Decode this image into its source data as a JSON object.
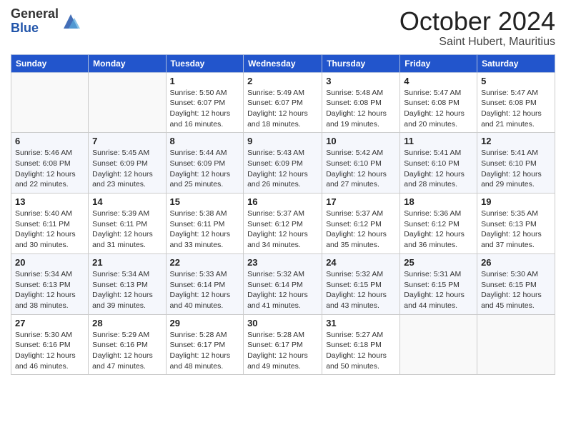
{
  "header": {
    "logo_general": "General",
    "logo_blue": "Blue",
    "month": "October 2024",
    "location": "Saint Hubert, Mauritius"
  },
  "days_of_week": [
    "Sunday",
    "Monday",
    "Tuesday",
    "Wednesday",
    "Thursday",
    "Friday",
    "Saturday"
  ],
  "weeks": [
    [
      {
        "day": "",
        "info": ""
      },
      {
        "day": "",
        "info": ""
      },
      {
        "day": "1",
        "info": "Sunrise: 5:50 AM\nSunset: 6:07 PM\nDaylight: 12 hours and 16 minutes."
      },
      {
        "day": "2",
        "info": "Sunrise: 5:49 AM\nSunset: 6:07 PM\nDaylight: 12 hours and 18 minutes."
      },
      {
        "day": "3",
        "info": "Sunrise: 5:48 AM\nSunset: 6:08 PM\nDaylight: 12 hours and 19 minutes."
      },
      {
        "day": "4",
        "info": "Sunrise: 5:47 AM\nSunset: 6:08 PM\nDaylight: 12 hours and 20 minutes."
      },
      {
        "day": "5",
        "info": "Sunrise: 5:47 AM\nSunset: 6:08 PM\nDaylight: 12 hours and 21 minutes."
      }
    ],
    [
      {
        "day": "6",
        "info": "Sunrise: 5:46 AM\nSunset: 6:08 PM\nDaylight: 12 hours and 22 minutes."
      },
      {
        "day": "7",
        "info": "Sunrise: 5:45 AM\nSunset: 6:09 PM\nDaylight: 12 hours and 23 minutes."
      },
      {
        "day": "8",
        "info": "Sunrise: 5:44 AM\nSunset: 6:09 PM\nDaylight: 12 hours and 25 minutes."
      },
      {
        "day": "9",
        "info": "Sunrise: 5:43 AM\nSunset: 6:09 PM\nDaylight: 12 hours and 26 minutes."
      },
      {
        "day": "10",
        "info": "Sunrise: 5:42 AM\nSunset: 6:10 PM\nDaylight: 12 hours and 27 minutes."
      },
      {
        "day": "11",
        "info": "Sunrise: 5:41 AM\nSunset: 6:10 PM\nDaylight: 12 hours and 28 minutes."
      },
      {
        "day": "12",
        "info": "Sunrise: 5:41 AM\nSunset: 6:10 PM\nDaylight: 12 hours and 29 minutes."
      }
    ],
    [
      {
        "day": "13",
        "info": "Sunrise: 5:40 AM\nSunset: 6:11 PM\nDaylight: 12 hours and 30 minutes."
      },
      {
        "day": "14",
        "info": "Sunrise: 5:39 AM\nSunset: 6:11 PM\nDaylight: 12 hours and 31 minutes."
      },
      {
        "day": "15",
        "info": "Sunrise: 5:38 AM\nSunset: 6:11 PM\nDaylight: 12 hours and 33 minutes."
      },
      {
        "day": "16",
        "info": "Sunrise: 5:37 AM\nSunset: 6:12 PM\nDaylight: 12 hours and 34 minutes."
      },
      {
        "day": "17",
        "info": "Sunrise: 5:37 AM\nSunset: 6:12 PM\nDaylight: 12 hours and 35 minutes."
      },
      {
        "day": "18",
        "info": "Sunrise: 5:36 AM\nSunset: 6:12 PM\nDaylight: 12 hours and 36 minutes."
      },
      {
        "day": "19",
        "info": "Sunrise: 5:35 AM\nSunset: 6:13 PM\nDaylight: 12 hours and 37 minutes."
      }
    ],
    [
      {
        "day": "20",
        "info": "Sunrise: 5:34 AM\nSunset: 6:13 PM\nDaylight: 12 hours and 38 minutes."
      },
      {
        "day": "21",
        "info": "Sunrise: 5:34 AM\nSunset: 6:13 PM\nDaylight: 12 hours and 39 minutes."
      },
      {
        "day": "22",
        "info": "Sunrise: 5:33 AM\nSunset: 6:14 PM\nDaylight: 12 hours and 40 minutes."
      },
      {
        "day": "23",
        "info": "Sunrise: 5:32 AM\nSunset: 6:14 PM\nDaylight: 12 hours and 41 minutes."
      },
      {
        "day": "24",
        "info": "Sunrise: 5:32 AM\nSunset: 6:15 PM\nDaylight: 12 hours and 43 minutes."
      },
      {
        "day": "25",
        "info": "Sunrise: 5:31 AM\nSunset: 6:15 PM\nDaylight: 12 hours and 44 minutes."
      },
      {
        "day": "26",
        "info": "Sunrise: 5:30 AM\nSunset: 6:15 PM\nDaylight: 12 hours and 45 minutes."
      }
    ],
    [
      {
        "day": "27",
        "info": "Sunrise: 5:30 AM\nSunset: 6:16 PM\nDaylight: 12 hours and 46 minutes."
      },
      {
        "day": "28",
        "info": "Sunrise: 5:29 AM\nSunset: 6:16 PM\nDaylight: 12 hours and 47 minutes."
      },
      {
        "day": "29",
        "info": "Sunrise: 5:28 AM\nSunset: 6:17 PM\nDaylight: 12 hours and 48 minutes."
      },
      {
        "day": "30",
        "info": "Sunrise: 5:28 AM\nSunset: 6:17 PM\nDaylight: 12 hours and 49 minutes."
      },
      {
        "day": "31",
        "info": "Sunrise: 5:27 AM\nSunset: 6:18 PM\nDaylight: 12 hours and 50 minutes."
      },
      {
        "day": "",
        "info": ""
      },
      {
        "day": "",
        "info": ""
      }
    ]
  ]
}
